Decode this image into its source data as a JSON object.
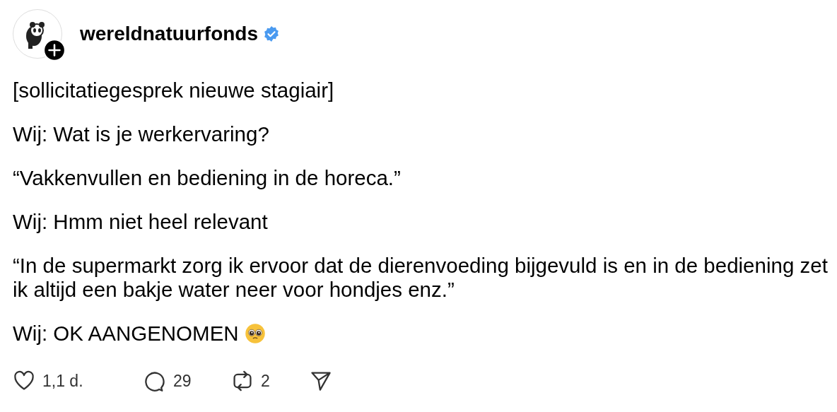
{
  "post": {
    "author": "wereldnatuurfonds",
    "verified": true,
    "paragraphs": [
      {
        "text": "[sollicitatiegesprek nieuwe stagiair]",
        "emoji": false
      },
      {
        "text": "Wij: Wat is je werkervaring?",
        "emoji": false
      },
      {
        "text": "“Vakkenvullen en bediening in de horeca.”",
        "emoji": false
      },
      {
        "text": "Wij: Hmm niet heel relevant",
        "emoji": false
      },
      {
        "text": "“In de supermarkt zorg ik ervoor dat de dierenvoeding bijgevuld is en in de bediening zet ik altijd een bakje water neer voor hondjes enz.”",
        "emoji": false
      },
      {
        "text": "Wij: OK AANGENOMEN",
        "emoji": true
      }
    ],
    "actions": [
      {
        "kind": "like",
        "count": "1,1 d."
      },
      {
        "kind": "reply",
        "count": "29"
      },
      {
        "kind": "repost",
        "count": "2"
      },
      {
        "kind": "share"
      }
    ]
  }
}
